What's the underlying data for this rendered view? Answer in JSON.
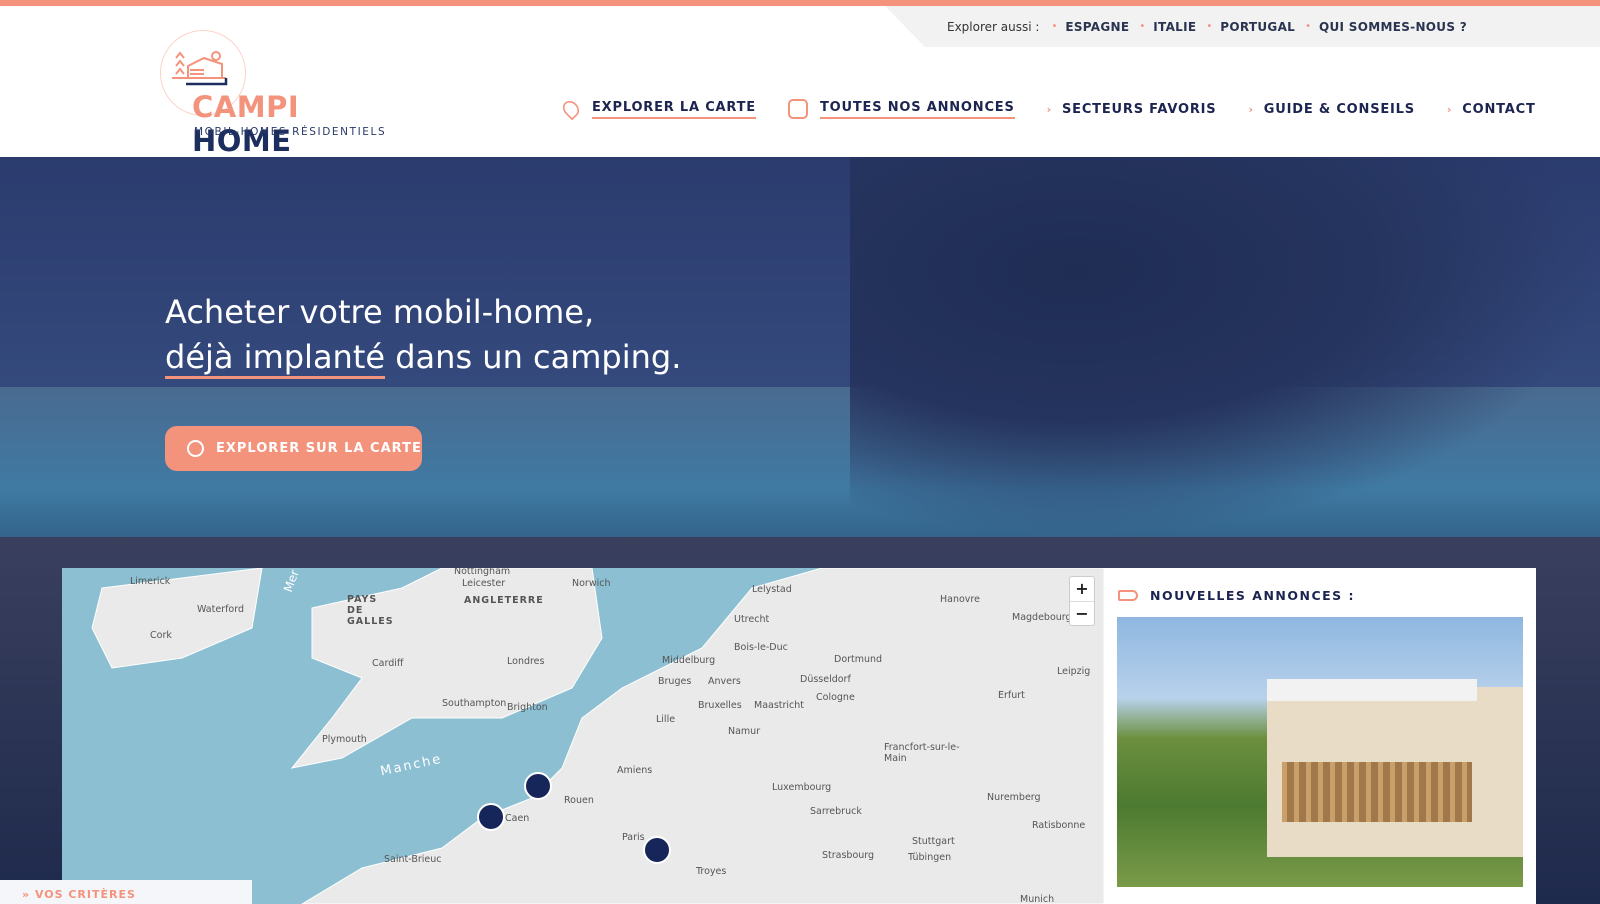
{
  "colors": {
    "accent": "#f4937c",
    "navy": "#1c2450"
  },
  "topbar": {
    "explore_label": "Explorer aussi :",
    "links": [
      "ESPAGNE",
      "ITALIE",
      "PORTUGAL",
      "QUI SOMMES-NOUS ?"
    ]
  },
  "logo": {
    "brand_a": "CAMPI",
    "brand_b": "HOME",
    "tagline": "MOBIL-HOMES RÉSIDENTIELS"
  },
  "nav": [
    {
      "label": "EXPLORER LA CARTE",
      "icon": "map-pin-icon"
    },
    {
      "label": "TOUTES NOS ANNONCES",
      "icon": "listings-icon"
    },
    {
      "label": "SECTEURS FAVORIS"
    },
    {
      "label": "GUIDE & CONSEILS"
    },
    {
      "label": "CONTACT"
    }
  ],
  "hero": {
    "line1": "Acheter votre mobil-home,",
    "line2_underlined": "déjà implanté",
    "line2_rest": " dans un camping.",
    "cta": "EXPLORER SUR LA CARTE"
  },
  "map": {
    "zoom_in": "+",
    "zoom_out": "−",
    "labels": [
      "Limerick",
      "Waterford",
      "Cork",
      "PAYS DE GALLES",
      "Cardiff",
      "Plymouth",
      "Nottingham",
      "Leicester",
      "ANGLETERRE",
      "Norwich",
      "Londres",
      "Southampton",
      "Brighton",
      "Manche",
      "Saint-Brieuc",
      "Caen",
      "Rouen",
      "Amiens",
      "Paris",
      "Troyes",
      "Lille",
      "Bruges",
      "Anvers",
      "Bruxelles",
      "Namur",
      "Maastricht",
      "Middelburg",
      "Bois-le-Duc",
      "Utrecht",
      "Lelystad",
      "Dortmund",
      "Düsseldorf",
      "Cologne",
      "Luxembourg",
      "Sarrebruck",
      "Strasbourg",
      "Hanovre",
      "Magdebourg",
      "Leipzig",
      "Erfurt",
      "Francfort-sur-le-Main",
      "Nuremberg",
      "Stuttgart",
      "Tübingen",
      "Ratisbonne",
      "Munich",
      "Mer"
    ]
  },
  "panel": {
    "title": "NOUVELLES ANNONCES :"
  },
  "criteria": {
    "label": "VOS CRITÈRES"
  }
}
